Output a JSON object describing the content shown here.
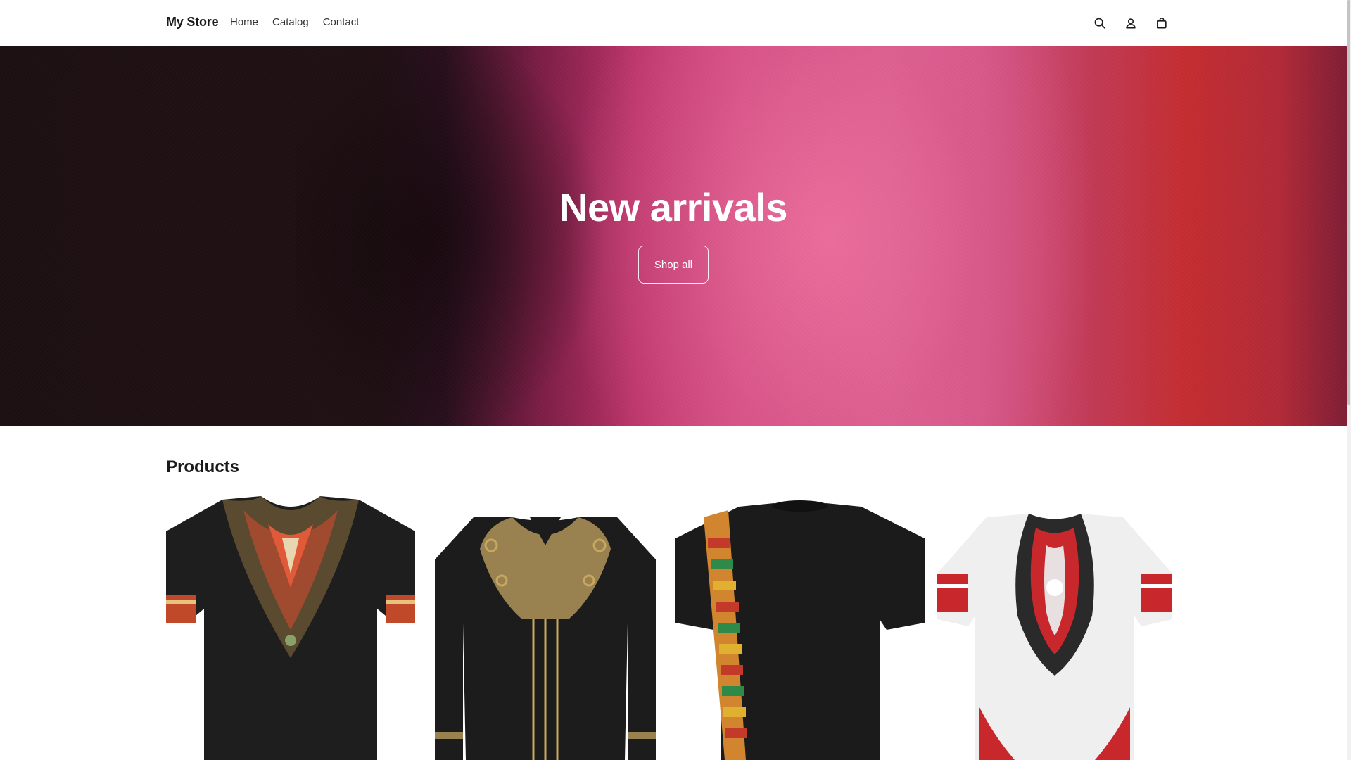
{
  "header": {
    "brand": "My Store",
    "nav": [
      "Home",
      "Catalog",
      "Contact"
    ],
    "icons": [
      "search-icon",
      "account-icon",
      "cart-icon"
    ]
  },
  "hero": {
    "title": "New arrivals",
    "button_label": "Shop all"
  },
  "products": {
    "title": "Products",
    "items": [
      {
        "image": "black dashiki t-shirt with red and gold V-neck print"
      },
      {
        "image": "black long-sleeve shirt with gold geometric embroidery"
      },
      {
        "image": "black t-shirt with kente print panel"
      },
      {
        "image": "white dashiki t-shirt with red and black print"
      }
    ]
  },
  "colors": {
    "accent": "#1a1a1a",
    "hero_dark": "#1c0f12",
    "hero_pink": "#dd6595",
    "hero_red": "#c42d30"
  }
}
